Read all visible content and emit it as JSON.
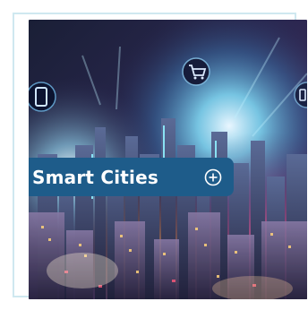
{
  "tile": {
    "label": "Smart Cities",
    "expand_icon": "circle-plus-icon",
    "image_icons": [
      "smartphone-icon",
      "shopping-cart-icon",
      "device-icon"
    ]
  },
  "colors": {
    "label_background": "#1e5c8a",
    "label_text": "#ffffff",
    "card_border": "#cfe8f0"
  }
}
